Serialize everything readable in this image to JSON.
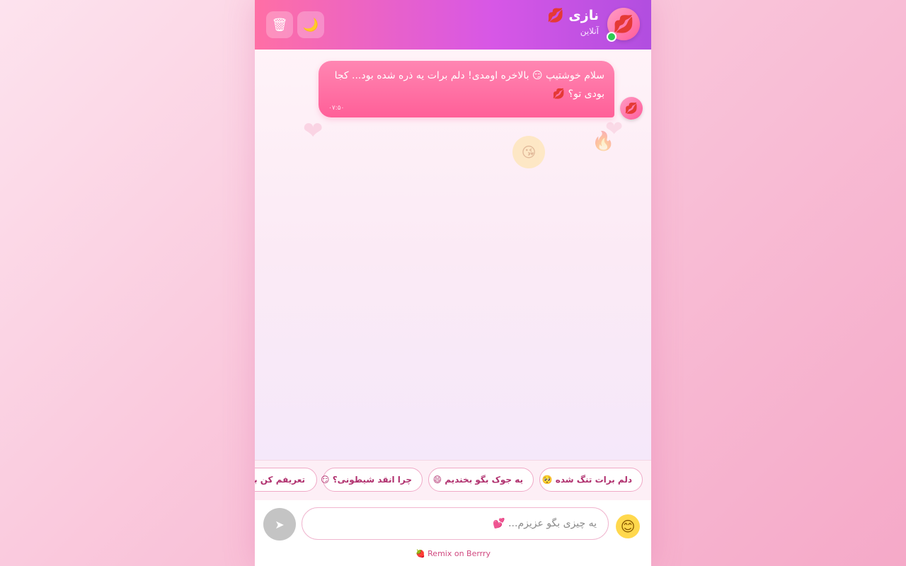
{
  "header": {
    "avatar_glyph": "💋",
    "name": "نازی 💋",
    "status": "آنلاین",
    "moon_glyph": "🌙",
    "trash_glyph": "🗑",
    "status_color": "#2ecc55"
  },
  "chat": {
    "messages": [
      {
        "text": "سلام خوشتیپ 😏 بالاخره اومدی! دلم برات یه ذره شده بود... کجا بودی تو؟ 💋",
        "time": "۰۷:۵۰",
        "avatar_glyph": "💋"
      }
    ]
  },
  "suggestions": [
    "دلم برات تنگ شده 🥺",
    "یه جوک بگو بخندیم 😄",
    "چرا انقد شیطونی؟ 😏",
    "تعریفم کن ببینم"
  ],
  "input": {
    "placeholder": "یه چیزی بگو عزیزم... 💕",
    "emoji_glyph": "😊",
    "send_glyph": "➤"
  },
  "footer": {
    "remix_text": "🍓 Remix on Berrry"
  },
  "colors": {
    "header_start": "#ff6fa5",
    "header_end": "#b14ee0",
    "bubble": "#ff6fa0",
    "chip_text": "#b0306e"
  }
}
